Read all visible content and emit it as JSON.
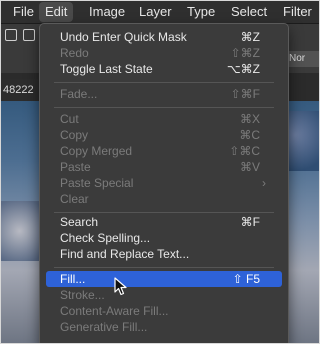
{
  "menubar": {
    "items": [
      "File",
      "Edit",
      "Image",
      "Layer",
      "Type",
      "Select",
      "Filter"
    ]
  },
  "options_bar": {
    "blend_label": "Nor",
    "doc_label": "48222"
  },
  "edit_menu": {
    "groups": [
      [
        {
          "label": "Undo Enter Quick Mask",
          "shortcut": "⌘Z",
          "enabled": true
        },
        {
          "label": "Redo",
          "shortcut": "⇧⌘Z",
          "enabled": false
        },
        {
          "label": "Toggle Last State",
          "shortcut": "⌥⌘Z",
          "enabled": true
        }
      ],
      [
        {
          "label": "Fade...",
          "shortcut": "⇧⌘F",
          "enabled": false
        }
      ],
      [
        {
          "label": "Cut",
          "shortcut": "⌘X",
          "enabled": false
        },
        {
          "label": "Copy",
          "shortcut": "⌘C",
          "enabled": false
        },
        {
          "label": "Copy Merged",
          "shortcut": "⇧⌘C",
          "enabled": false
        },
        {
          "label": "Paste",
          "shortcut": "⌘V",
          "enabled": false
        },
        {
          "label": "Paste Special",
          "shortcut": "",
          "enabled": false,
          "submenu": true
        },
        {
          "label": "Clear",
          "shortcut": "",
          "enabled": false
        }
      ],
      [
        {
          "label": "Search",
          "shortcut": "⌘F",
          "enabled": true
        },
        {
          "label": "Check Spelling...",
          "shortcut": "",
          "enabled": true
        },
        {
          "label": "Find and Replace Text...",
          "shortcut": "",
          "enabled": true
        }
      ],
      [
        {
          "label": "Fill...",
          "shortcut": "⇧ F5",
          "enabled": true,
          "selected": true
        },
        {
          "label": "Stroke...",
          "shortcut": "",
          "enabled": false
        },
        {
          "label": "Content-Aware Fill...",
          "shortcut": "",
          "enabled": false
        },
        {
          "label": "Generative Fill...",
          "shortcut": "",
          "enabled": false
        }
      ]
    ]
  },
  "colors": {
    "highlight": "#2e62d8",
    "menu_bg": "#3b3b3b",
    "disabled_text": "#7b7b7b"
  }
}
